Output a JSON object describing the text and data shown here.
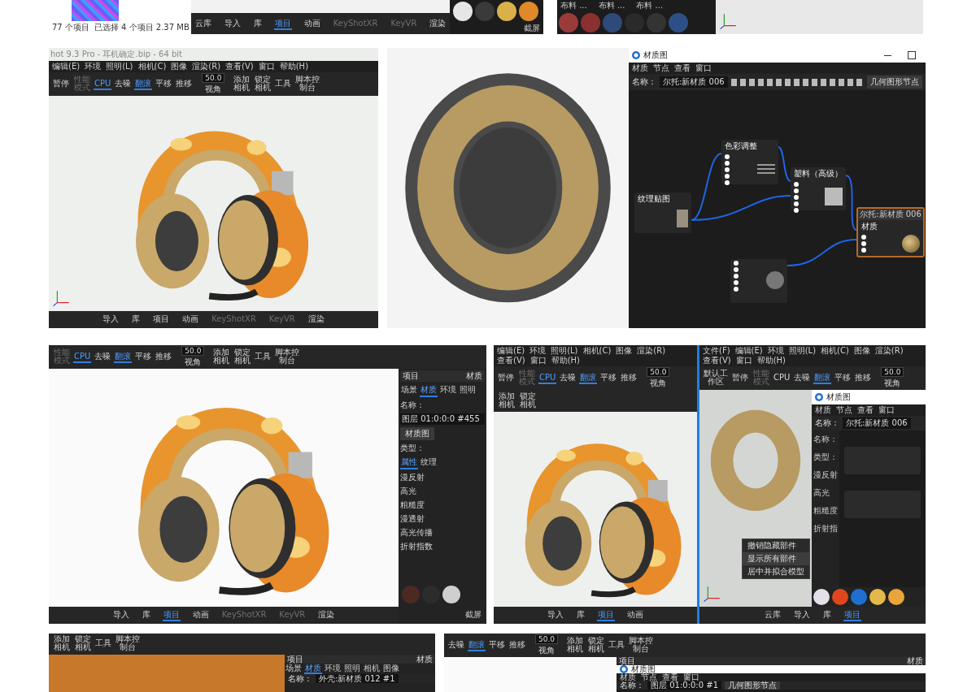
{
  "explorer_strip": {
    "status": [
      "77 个项目",
      "已选择 4 个项目  2.37 MB"
    ]
  },
  "strip_toolbar": [
    {
      "label": "云库",
      "selected": false,
      "disabled": false
    },
    {
      "label": "导入",
      "selected": false,
      "disabled": false
    },
    {
      "label": "库",
      "selected": false,
      "disabled": false
    },
    {
      "label": "项目",
      "selected": true,
      "disabled": false
    },
    {
      "label": "动画",
      "selected": false,
      "disabled": false
    },
    {
      "label": "KeyShotXR",
      "selected": false,
      "disabled": true
    },
    {
      "label": "KeyVR",
      "selected": false,
      "disabled": true
    },
    {
      "label": "渲染",
      "selected": false,
      "disabled": false
    }
  ],
  "strip_swatches": [
    {
      "color": "#e6e6e6"
    },
    {
      "color": "#3a3a3a"
    },
    {
      "color": "#d9b04a"
    },
    {
      "color": "#e0892a"
    }
  ],
  "strip_screenshot": "截屏",
  "library_labels": [
    "布料 ...",
    "布料 ...",
    "布料 ..."
  ],
  "library_swatches": [
    {
      "color": "#9b3a3a"
    },
    {
      "color": "#8a3030"
    },
    {
      "color": "#2e4a7a"
    },
    {
      "color": "#2a2a2a"
    },
    {
      "color": "#333333"
    },
    {
      "color": "#2d4f86"
    }
  ],
  "keyshot_window": {
    "title": "hot 9.3 Pro - 耳机确定.bip - 64 bit",
    "menu": [
      "编辑(E)",
      "环境",
      "照明(L)",
      "相机(C)",
      "图像",
      "渲染(R)",
      "查看(V)",
      "窗口",
      "帮助(H)"
    ],
    "toolbar": [
      {
        "kind": "button",
        "label": "暂停",
        "selected": false,
        "disabled": false
      },
      {
        "kind": "button",
        "label": "性能模式",
        "selected": false,
        "disabled": true
      },
      {
        "kind": "button",
        "label": "CPU",
        "selected": true,
        "disabled": false
      },
      {
        "kind": "button",
        "label": "去噪",
        "selected": false,
        "disabled": false
      },
      {
        "kind": "button",
        "label": "翻滚",
        "selected": true,
        "disabled": false
      },
      {
        "kind": "button",
        "label": "平移",
        "selected": false,
        "disabled": false
      },
      {
        "kind": "button",
        "label": "推移",
        "selected": false,
        "disabled": false
      },
      {
        "kind": "fov",
        "value": "50.0",
        "label": "视角"
      },
      {
        "kind": "button",
        "label": "添加相机",
        "selected": false,
        "disabled": false
      },
      {
        "kind": "button",
        "label": "锁定相机",
        "selected": false,
        "disabled": false
      },
      {
        "kind": "button",
        "label": "工具",
        "selected": false,
        "disabled": false
      },
      {
        "kind": "button",
        "label": "脚本控制台",
        "selected": false,
        "disabled": false
      }
    ],
    "bottom_toolbar": [
      {
        "label": "导入",
        "selected": false,
        "disabled": false
      },
      {
        "label": "库",
        "selected": false,
        "disabled": false
      },
      {
        "label": "项目",
        "selected": false,
        "disabled": false
      },
      {
        "label": "动画",
        "selected": false,
        "disabled": false
      },
      {
        "label": "KeyShotXR",
        "selected": false,
        "disabled": true
      },
      {
        "label": "KeyVR",
        "selected": false,
        "disabled": true
      },
      {
        "label": "渲染",
        "selected": false,
        "disabled": false
      }
    ]
  },
  "material_graph": {
    "title": "材质图",
    "menu": [
      "材质",
      "节点",
      "查看",
      "窗口"
    ],
    "name_label": "名称：",
    "name_value": "尔托:新材质 006",
    "geometry_button": "几何图形节点",
    "nodes": [
      {
        "title": "色彩调整",
        "selected": false
      },
      {
        "title": "塑料（高级）",
        "selected": false
      },
      {
        "title": "纹理贴图",
        "selected": false
      },
      {
        "header": "尔托:新材质 006",
        "title": "材质",
        "selected": true
      },
      {
        "selected": false
      }
    ]
  },
  "closeup_window": {
    "toolbar": [
      {
        "kind": "button",
        "label": "性能模式",
        "selected": false,
        "disabled": true
      },
      {
        "kind": "button",
        "label": "CPU",
        "selected": true,
        "disabled": false
      },
      {
        "kind": "button",
        "label": "去噪",
        "selected": false,
        "disabled": false
      },
      {
        "kind": "button",
        "label": "翻滚",
        "selected": true,
        "disabled": false
      },
      {
        "kind": "button",
        "label": "平移",
        "selected": false,
        "disabled": false
      },
      {
        "kind": "button",
        "label": "推移",
        "selected": false,
        "disabled": false
      },
      {
        "kind": "fov",
        "value": "50.0",
        "label": "视角"
      },
      {
        "kind": "button",
        "label": "添加相机",
        "selected": false,
        "disabled": false
      },
      {
        "kind": "button",
        "label": "锁定相机",
        "selected": false,
        "disabled": false
      },
      {
        "kind": "button",
        "label": "工具",
        "selected": false,
        "disabled": false
      },
      {
        "kind": "button",
        "label": "脚本控制台",
        "selected": false,
        "disabled": false
      }
    ],
    "panel_header": [
      "项目",
      "材质"
    ],
    "tabs": [
      {
        "label": "场景",
        "selected": false
      },
      {
        "label": "材质",
        "selected": true
      },
      {
        "label": "环境",
        "selected": false
      },
      {
        "label": "照明",
        "selected": false
      }
    ],
    "name_label": "名称：",
    "name_value": "图层 01:0:0:0 #455",
    "graph_button": "材质图",
    "type_label": "类型：",
    "subtabs": [
      {
        "label": "属性",
        "selected": true
      },
      {
        "label": "纹理",
        "selected": false
      }
    ],
    "properties": [
      "漫反射",
      "高光",
      "粗糙度",
      "漫透射",
      "高光传播",
      "折射指数"
    ],
    "swatches": [
      {
        "color": "#4a2a22"
      },
      {
        "color": "#2c2c2c"
      },
      {
        "color": "#cfcfcf"
      }
    ],
    "bottom_toolbar": [
      {
        "label": "导入",
        "selected": false,
        "disabled": false
      },
      {
        "label": "库",
        "selected": false,
        "disabled": false
      },
      {
        "label": "项目",
        "selected": true,
        "disabled": false
      },
      {
        "label": "动画",
        "selected": false,
        "disabled": false
      },
      {
        "label": "KeyShotXR",
        "selected": false,
        "disabled": true
      },
      {
        "label": "KeyVR",
        "selected": false,
        "disabled": true
      },
      {
        "label": "渲染",
        "selected": false,
        "disabled": false
      }
    ],
    "screenshot": "截屏"
  },
  "split_view": {
    "left": {
      "menu": [
        "编辑(E)",
        "环境",
        "照明(L)",
        "相机(C)",
        "图像",
        "渲染(R)",
        "查看(V)",
        "窗口",
        "帮助(H)"
      ],
      "toolbar": [
        {
          "kind": "button",
          "label": "暂停",
          "selected": false,
          "disabled": false
        },
        {
          "kind": "button",
          "label": "性能模式",
          "selected": false,
          "disabled": true
        },
        {
          "kind": "button",
          "label": "CPU",
          "selected": true,
          "disabled": false
        },
        {
          "kind": "button",
          "label": "去噪",
          "selected": false,
          "disabled": false
        },
        {
          "kind": "button",
          "label": "翻滚",
          "selected": true,
          "disabled": false
        },
        {
          "kind": "button",
          "label": "平移",
          "selected": false,
          "disabled": false
        },
        {
          "kind": "button",
          "label": "推移",
          "selected": false,
          "disabled": false
        },
        {
          "kind": "fov",
          "value": "50.0",
          "label": "视角"
        },
        {
          "kind": "button",
          "label": "添加相机",
          "selected": false,
          "disabled": false
        },
        {
          "kind": "button",
          "label": "锁定相机",
          "selected": false,
          "disabled": false
        }
      ],
      "bottom_toolbar": [
        {
          "label": "导入",
          "selected": false,
          "disabled": false
        },
        {
          "label": "库",
          "selected": false,
          "disabled": false
        },
        {
          "label": "项目",
          "selected": true,
          "disabled": false
        },
        {
          "label": "动画",
          "selected": false,
          "disabled": false
        }
      ]
    },
    "right": {
      "menu": [
        "文件(F)",
        "编辑(E)",
        "环境",
        "照明(L)",
        "相机(C)",
        "图像",
        "渲染(R)",
        "查看(V)",
        "窗口",
        "帮助(H)"
      ],
      "toolbar": [
        {
          "kind": "button",
          "label": "默认工作区",
          "selected": false,
          "disabled": false
        },
        {
          "kind": "button",
          "label": "暂停",
          "selected": false,
          "disabled": false
        },
        {
          "kind": "button",
          "label": "性能模式",
          "selected": false,
          "disabled": true
        },
        {
          "kind": "button",
          "label": "CPU",
          "selected": false,
          "disabled": false
        },
        {
          "kind": "button",
          "label": "去噪",
          "selected": false,
          "disabled": false
        },
        {
          "kind": "button",
          "label": "翻滚",
          "selected": true,
          "disabled": false
        },
        {
          "kind": "button",
          "label": "平移",
          "selected": false,
          "disabled": false
        },
        {
          "kind": "button",
          "label": "推移",
          "selected": false,
          "disabled": false
        },
        {
          "kind": "fov",
          "value": "50.0",
          "label": "视角"
        }
      ],
      "graph": {
        "title": "材质图",
        "menu": [
          "材质",
          "节点",
          "查看",
          "窗口"
        ],
        "name_label": "名称：",
        "name_value": "尔托:新材质 006",
        "side_labels": [
          "名称：",
          "类型：",
          "漫反射",
          "高光",
          "粗糙度",
          "折射指"
        ]
      },
      "context_menu": [
        {
          "label": "撤销隐藏部件",
          "selected": false
        },
        {
          "label": "显示所有部件",
          "selected": true
        },
        {
          "label": "居中并拟合模型",
          "selected": false
        }
      ],
      "swatches": [
        {
          "color": "#e4dfe8"
        },
        {
          "color": "#e0461c"
        },
        {
          "color": "#1f6fd1"
        },
        {
          "color": "#e5b84a"
        },
        {
          "color": "#e9a53a"
        }
      ],
      "bottom_toolbar": [
        {
          "label": "云库",
          "selected": false,
          "disabled": false
        },
        {
          "label": "导入",
          "selected": false,
          "disabled": false
        },
        {
          "label": "库",
          "selected": false,
          "disabled": false
        },
        {
          "label": "项目",
          "selected": true,
          "disabled": false
        }
      ]
    }
  },
  "bottom_left": {
    "toolbar": [
      {
        "kind": "button",
        "label": "添加相机",
        "selected": false,
        "disabled": false
      },
      {
        "kind": "button",
        "label": "锁定相机",
        "selected": false,
        "disabled": false
      },
      {
        "kind": "button",
        "label": "工具",
        "selected": false,
        "disabled": false
      },
      {
        "kind": "button",
        "label": "脚本控制台",
        "selected": false,
        "disabled": false
      }
    ],
    "panel_header": [
      "项目",
      "材质"
    ],
    "tabs": [
      {
        "label": "场景",
        "selected": false
      },
      {
        "label": "材质",
        "selected": true
      },
      {
        "label": "环境",
        "selected": false
      },
      {
        "label": "照明",
        "selected": false
      },
      {
        "label": "相机",
        "selected": false
      },
      {
        "label": "图像",
        "selected": false
      }
    ],
    "name_label": "名称：",
    "name_value": "外壳:新材质 012 #1"
  },
  "bottom_right": {
    "toolbar": [
      {
        "kind": "button",
        "label": "去噪",
        "selected": false,
        "disabled": false
      },
      {
        "kind": "button",
        "label": "翻滚",
        "selected": true,
        "disabled": false
      },
      {
        "kind": "button",
        "label": "平移",
        "selected": false,
        "disabled": false
      },
      {
        "kind": "button",
        "label": "推移",
        "selected": false,
        "disabled": false
      },
      {
        "kind": "fov",
        "value": "50.0",
        "label": "视角"
      },
      {
        "kind": "button",
        "label": "添加相机",
        "selected": false,
        "disabled": false
      },
      {
        "kind": "button",
        "label": "锁定相机",
        "selected": false,
        "disabled": false
      },
      {
        "kind": "button",
        "label": "工具",
        "selected": false,
        "disabled": false
      },
      {
        "kind": "button",
        "label": "脚本控制台",
        "selected": false,
        "disabled": false
      }
    ],
    "panel_header": [
      "项目",
      "材质"
    ],
    "graph_title": "材质图",
    "graph_menu": [
      "材质",
      "节点",
      "查看",
      "窗口"
    ],
    "name_label": "名称：",
    "name_value": "图层 01:0:0:0 #1",
    "geometry_button": "几何图形节点"
  }
}
